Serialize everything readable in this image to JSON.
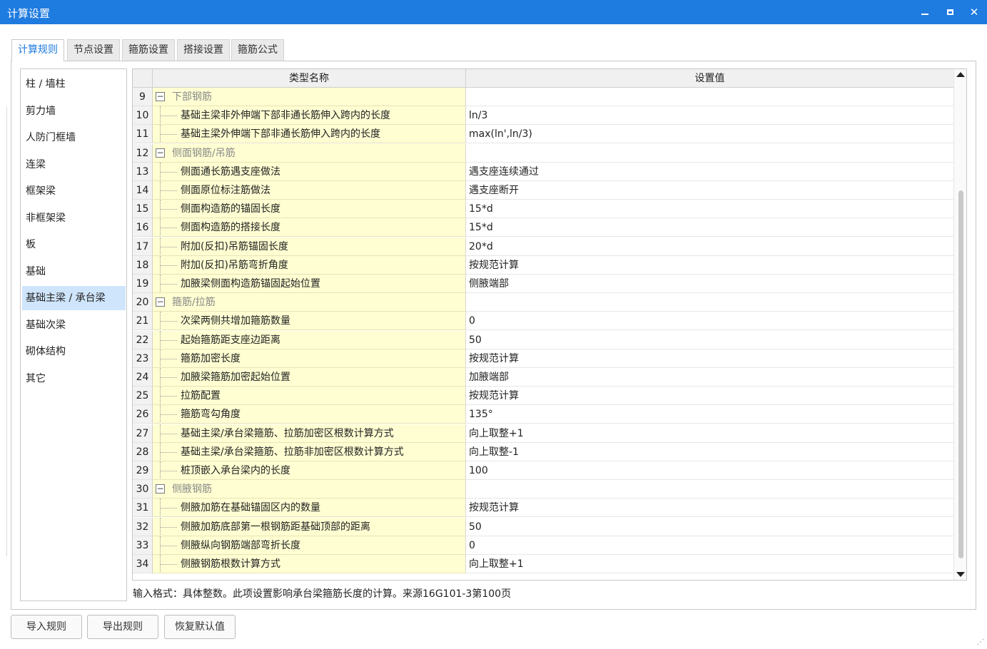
{
  "window": {
    "title": "计算设置",
    "minimize": "‗",
    "maximize": "□",
    "close": "✕"
  },
  "tabs": [
    {
      "label": "计算规则",
      "active": true
    },
    {
      "label": "节点设置",
      "active": false
    },
    {
      "label": "箍筋设置",
      "active": false
    },
    {
      "label": "搭接设置",
      "active": false
    },
    {
      "label": "箍筋公式",
      "active": false
    }
  ],
  "categories": [
    {
      "label": "柱 / 墙柱",
      "selected": false
    },
    {
      "label": "剪力墙",
      "selected": false
    },
    {
      "label": "人防门框墙",
      "selected": false
    },
    {
      "label": "连梁",
      "selected": false
    },
    {
      "label": "框架梁",
      "selected": false
    },
    {
      "label": "非框架梁",
      "selected": false
    },
    {
      "label": "板",
      "selected": false
    },
    {
      "label": "基础",
      "selected": false
    },
    {
      "label": "基础主梁 / 承台梁",
      "selected": true
    },
    {
      "label": "基础次梁",
      "selected": false
    },
    {
      "label": "砌体结构",
      "selected": false
    },
    {
      "label": "其它",
      "selected": false
    }
  ],
  "grid": {
    "headers": {
      "name": "类型名称",
      "value": "设置值"
    },
    "rows": [
      {
        "num": "9",
        "group": true,
        "name": "下部钢筋",
        "value": ""
      },
      {
        "num": "10",
        "group": false,
        "name": "基础主梁非外伸端下部非通长筋伸入跨内的长度",
        "value": "ln/3"
      },
      {
        "num": "11",
        "group": false,
        "name": "基础主梁外伸端下部非通长筋伸入跨内的长度",
        "value": "max(ln',ln/3)"
      },
      {
        "num": "12",
        "group": true,
        "name": "侧面钢筋/吊筋",
        "value": ""
      },
      {
        "num": "13",
        "group": false,
        "name": "侧面通长筋遇支座做法",
        "value": "遇支座连续通过"
      },
      {
        "num": "14",
        "group": false,
        "name": "侧面原位标注筋做法",
        "value": "遇支座断开"
      },
      {
        "num": "15",
        "group": false,
        "name": "侧面构造筋的锚固长度",
        "value": "15*d"
      },
      {
        "num": "16",
        "group": false,
        "name": "侧面构造筋的搭接长度",
        "value": "15*d"
      },
      {
        "num": "17",
        "group": false,
        "name": "附加(反扣)吊筋锚固长度",
        "value": "20*d"
      },
      {
        "num": "18",
        "group": false,
        "name": "附加(反扣)吊筋弯折角度",
        "value": "按规范计算"
      },
      {
        "num": "19",
        "group": false,
        "name": "加腋梁侧面构造筋锚固起始位置",
        "value": "侧腋端部"
      },
      {
        "num": "20",
        "group": true,
        "name": "箍筋/拉筋",
        "value": ""
      },
      {
        "num": "21",
        "group": false,
        "name": "次梁两侧共增加箍筋数量",
        "value": "0"
      },
      {
        "num": "22",
        "group": false,
        "name": "起始箍筋距支座边距离",
        "value": "50"
      },
      {
        "num": "23",
        "group": false,
        "name": "箍筋加密长度",
        "value": "按规范计算"
      },
      {
        "num": "24",
        "group": false,
        "name": "加腋梁箍筋加密起始位置",
        "value": "加腋端部"
      },
      {
        "num": "25",
        "group": false,
        "name": "拉筋配置",
        "value": "按规范计算"
      },
      {
        "num": "26",
        "group": false,
        "name": "箍筋弯勾角度",
        "value": "135°"
      },
      {
        "num": "27",
        "group": false,
        "name": "基础主梁/承台梁箍筋、拉筋加密区根数计算方式",
        "value": "向上取整+1"
      },
      {
        "num": "28",
        "group": false,
        "name": "基础主梁/承台梁箍筋、拉筋非加密区根数计算方式",
        "value": "向上取整-1"
      },
      {
        "num": "29",
        "group": false,
        "name": "桩顶嵌入承台梁内的长度",
        "value": "100"
      },
      {
        "num": "30",
        "group": true,
        "name": "侧腋钢筋",
        "value": ""
      },
      {
        "num": "31",
        "group": false,
        "name": "侧腋加筋在基础锚固区内的数量",
        "value": "按规范计算"
      },
      {
        "num": "32",
        "group": false,
        "name": "侧腋加筋底部第一根钢筋距基础顶部的距离",
        "value": "50"
      },
      {
        "num": "33",
        "group": false,
        "name": "侧腋纵向钢筋端部弯折长度",
        "value": "0"
      },
      {
        "num": "34",
        "group": false,
        "name": "侧腋钢筋根数计算方式",
        "value": "向上取整+1"
      }
    ]
  },
  "hint": "输入格式：具体整数。此项设置影响承台梁箍筋长度的计算。来源16G101-3第100页",
  "buttons": {
    "import": "导入规则",
    "export": "导出规则",
    "restore": "恢复默认值"
  }
}
